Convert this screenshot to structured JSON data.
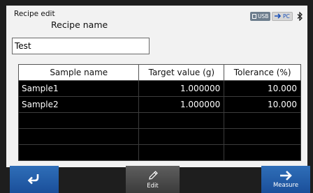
{
  "window": {
    "title": "Recipe edit"
  },
  "status": {
    "usb_label": "USB",
    "pc_label": "PC"
  },
  "form": {
    "name_label": "Recipe name",
    "name_value": "Test"
  },
  "table": {
    "headers": [
      "Sample name",
      "Target value (g)",
      "Tolerance (%)"
    ],
    "rows": [
      [
        "Sample1",
        "1.000000",
        "10.000"
      ],
      [
        "Sample2",
        "1.000000",
        "10.000"
      ],
      [
        "",
        "",
        ""
      ],
      [
        "",
        "",
        ""
      ],
      [
        "",
        "",
        ""
      ]
    ]
  },
  "toolbar": {
    "back_label": "",
    "edit_label": "Edit",
    "measure_label": "Measure"
  },
  "icons": {
    "back": "return-arrow-icon",
    "edit": "pencil-icon",
    "measure": "right-arrow-icon",
    "bluetooth": "bluetooth-icon"
  },
  "colors": {
    "accent": "#1f5aa6",
    "table_body": "#000000",
    "panel": "#f2f2f2"
  }
}
